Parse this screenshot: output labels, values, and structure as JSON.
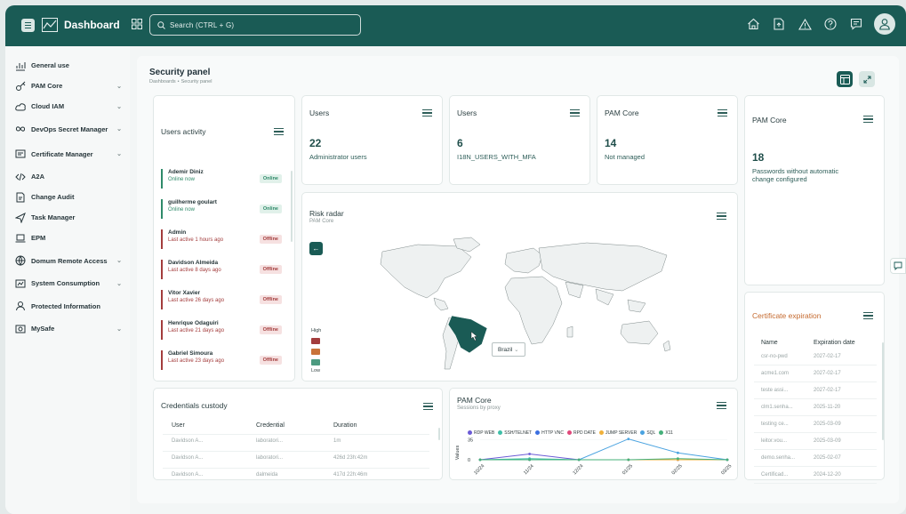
{
  "topbar": {
    "brand": "Dashboard",
    "search_placeholder": "Search (CTRL + G)"
  },
  "sidebar": {
    "items": [
      {
        "label": "General use",
        "icon": "analytics-icon",
        "chevron": false
      },
      {
        "label": "PAM Core",
        "icon": "key-icon",
        "chevron": true
      },
      {
        "label": "Cloud IAM",
        "icon": "cloud-icon",
        "chevron": true
      },
      {
        "label": "DevOps Secret Manager",
        "icon": "infinity-icon",
        "chevron": true
      },
      {
        "label": "Certificate Manager",
        "icon": "certificate-icon",
        "chevron": true
      },
      {
        "label": "A2A",
        "icon": "code-icon",
        "chevron": false
      },
      {
        "label": "Change Audit",
        "icon": "file-audit-icon",
        "chevron": false
      },
      {
        "label": "Task Manager",
        "icon": "send-icon",
        "chevron": false
      },
      {
        "label": "EPM",
        "icon": "laptop-icon",
        "chevron": false
      },
      {
        "label": "Domum Remote Access",
        "icon": "globe-icon",
        "chevron": true
      },
      {
        "label": "System Consumption",
        "icon": "gauge-icon",
        "chevron": true
      },
      {
        "label": "Protected Information",
        "icon": "user-shield-icon",
        "chevron": false
      },
      {
        "label": "MySafe",
        "icon": "safe-icon",
        "chevron": true
      }
    ]
  },
  "page": {
    "title": "Security panel",
    "breadcrumb": [
      "Dashboards",
      "Security panel"
    ]
  },
  "users_activity": {
    "title": "Users activity",
    "rows": [
      {
        "name": "Ademir Diniz",
        "status": "Online now",
        "badge": "Online",
        "online": true
      },
      {
        "name": "guilherme goulart",
        "status": "Online now",
        "badge": "Online",
        "online": true
      },
      {
        "name": "Admin",
        "status": "Last active 1 hours ago",
        "badge": "Offline",
        "online": false
      },
      {
        "name": "Davidson Almeida",
        "status": "Last active 8 days ago",
        "badge": "Offline",
        "online": false
      },
      {
        "name": "Vitor Xavier",
        "status": "Last active 26 days ago",
        "badge": "Offline",
        "online": false
      },
      {
        "name": "Henrique Odaguiri",
        "status": "Last active 21 days ago",
        "badge": "Offline",
        "online": false
      },
      {
        "name": "Gabriel Simoura",
        "status": "Last active 23 days ago",
        "badge": "Offline",
        "online": false
      }
    ]
  },
  "stat_cards": [
    {
      "title": "Users",
      "value": "22",
      "label": "Administrator users"
    },
    {
      "title": "Users",
      "value": "6",
      "label": "I18N_USERS_WITH_MFA"
    },
    {
      "title": "PAM Core",
      "value": "14",
      "label": "Not managed"
    }
  ],
  "pam_core_card": {
    "title": "PAM Core",
    "value": "18",
    "label": "Passwords without automatic change configured"
  },
  "risk_radar": {
    "title": "Risk radar",
    "subtitle": "PAM Core",
    "legend_high": "High",
    "legend_low": "Low",
    "legend_colors": [
      "#a33d3d",
      "#c9733a",
      "#4c9a80"
    ],
    "selected_country": "Brazil",
    "highlight_color": "#1a5b55"
  },
  "certificate_expiration": {
    "title": "Certificate expiration",
    "headers": [
      "Name",
      "Expiration date"
    ],
    "rows": [
      [
        "csr-no-pwd",
        "2027-02-17"
      ],
      [
        "acme1.com",
        "2027-02-17"
      ],
      [
        "teste assi...",
        "2027-02-17"
      ],
      [
        "clm1.senha...",
        "2025-11-20"
      ],
      [
        "testing ce...",
        "2025-03-09"
      ],
      [
        "leitor.vou...",
        "2025-03-09"
      ],
      [
        "demo.senha...",
        "2025-02-07"
      ],
      [
        "Certificad...",
        "2024-12-20"
      ]
    ]
  },
  "credentials_custody": {
    "title": "Credentials custody",
    "headers": [
      "User",
      "Credential",
      "Duration"
    ],
    "rows": [
      [
        "Davidson A...",
        "laboratori...",
        "1m"
      ],
      [
        "Davidson A...",
        "laboratori...",
        "426d 23h:42m"
      ],
      [
        "Davidson A...",
        "dalmeida",
        "417d 22h:46m"
      ]
    ]
  },
  "sessions_chart": {
    "title": "PAM Core",
    "subtitle": "Sessions by proxy",
    "y_axis_label": "Values",
    "y_ticks": [
      "35",
      "0"
    ]
  },
  "chart_data": {
    "type": "line",
    "x": [
      "10/24",
      "11/24",
      "12/24",
      "01/25",
      "02/25",
      "03/25"
    ],
    "ylim": [
      0,
      40
    ],
    "legend_placement": "top",
    "series": [
      {
        "name": "RDP WEB",
        "color": "#6b5bd6",
        "values": [
          0,
          10,
          0,
          0,
          0,
          0
        ]
      },
      {
        "name": "SSH/TELNET",
        "color": "#3fbfa8",
        "values": [
          0,
          2,
          0,
          0,
          0,
          0
        ]
      },
      {
        "name": "HTTP VNC",
        "color": "#3b6fe0",
        "values": [
          0,
          0,
          0,
          0,
          0,
          0
        ]
      },
      {
        "name": "RPD DATE",
        "color": "#e0487a",
        "values": [
          0,
          0,
          0,
          0,
          0,
          0
        ]
      },
      {
        "name": "JUMP SERVER",
        "color": "#f0b13a",
        "values": [
          0,
          0,
          0,
          0,
          0,
          0
        ]
      },
      {
        "name": "SQL",
        "color": "#4aa3e0",
        "values": [
          0,
          0,
          0,
          36,
          12,
          0
        ]
      },
      {
        "name": "X11",
        "color": "#45b07a",
        "values": [
          0,
          0,
          0,
          0,
          2,
          0
        ]
      }
    ]
  }
}
